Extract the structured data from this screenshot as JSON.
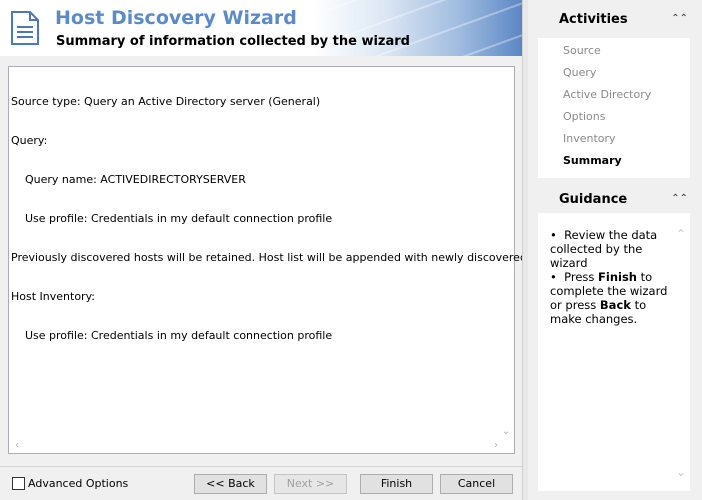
{
  "header": {
    "title": "Host Discovery Wizard",
    "subtitle": "Summary of information collected by the wizard"
  },
  "summary": {
    "lines": [
      "Source type: Query an Active Directory server (General)",
      "Query:",
      "    Query name: ACTIVEDIRECTORYSERVER",
      "    Use profile: Credentials in my default connection profile",
      "Previously discovered hosts will be retained. Host list will be appended with newly discovered hosts.",
      "Host Inventory:",
      "    Use profile: Credentials in my default connection profile"
    ]
  },
  "footer": {
    "advanced_options_label": "Advanced Options",
    "back_label": "<< Back",
    "next_label": "Next >>",
    "finish_label": "Finish",
    "cancel_label": "Cancel"
  },
  "activities": {
    "title": "Activities",
    "items": [
      {
        "label": "Source",
        "current": false
      },
      {
        "label": "Query",
        "current": false
      },
      {
        "label": "Active Directory",
        "current": false
      },
      {
        "label": "Options",
        "current": false
      },
      {
        "label": "Inventory",
        "current": false
      },
      {
        "label": "Summary",
        "current": true
      }
    ]
  },
  "guidance": {
    "title": "Guidance",
    "bullet1": "Review the data collected by the wizard",
    "bullet2_pre": "Press ",
    "bullet2_finish": "Finish",
    "bullet2_mid": " to complete the wizard or press ",
    "bullet2_back": "Back",
    "bullet2_post": " to make changes."
  },
  "icons": {
    "header": "document-icon",
    "collapse": "double-chevron-up-icon"
  },
  "colors": {
    "title": "#5b8bc6",
    "muted_activity": "#8a8a8a"
  }
}
